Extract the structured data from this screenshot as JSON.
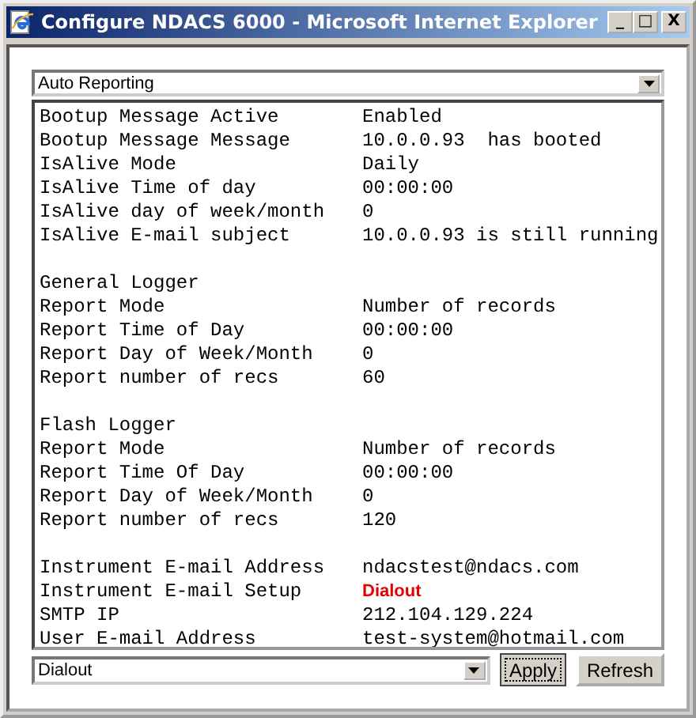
{
  "window": {
    "title": "Configure NDACS 6000 - Microsoft Internet Explorer"
  },
  "title_buttons": [
    "_",
    "□",
    "X"
  ],
  "top_select": {
    "value": "Auto Reporting"
  },
  "sections": [
    {
      "rows": [
        {
          "label": "Bootup Message Active",
          "value": "Enabled",
          "highlighted": false
        },
        {
          "label": "Bootup Message Message",
          "value": "10.0.0.93  has booted",
          "highlighted": false
        },
        {
          "label": "IsAlive Mode",
          "value": "Daily",
          "highlighted": false
        },
        {
          "label": "IsAlive Time of day",
          "value": "00:00:00",
          "highlighted": false
        },
        {
          "label": "IsAlive day of week/month",
          "value": "0",
          "highlighted": false
        },
        {
          "label": "IsAlive E-mail subject",
          "value": "10.0.0.93 is still running",
          "highlighted": false
        }
      ]
    },
    {
      "heading": "General Logger",
      "rows": [
        {
          "label": "Report Mode",
          "value": "Number of records",
          "highlighted": false
        },
        {
          "label": "Report Time of Day",
          "value": "00:00:00",
          "highlighted": false
        },
        {
          "label": "Report Day of Week/Month",
          "value": "0",
          "highlighted": false
        },
        {
          "label": "Report number of recs",
          "value": "60",
          "highlighted": false
        }
      ]
    },
    {
      "heading": "Flash Logger",
      "rows": [
        {
          "label": "Report Mode",
          "value": "Number of records",
          "highlighted": false
        },
        {
          "label": "Report Time Of Day",
          "value": "00:00:00",
          "highlighted": false
        },
        {
          "label": "Report Day of Week/Month",
          "value": "0",
          "highlighted": false
        },
        {
          "label": "Report number of recs",
          "value": "120",
          "highlighted": false
        }
      ]
    },
    {
      "rows": [
        {
          "label": "Instrument E-mail Address",
          "value": "ndacstest@ndacs.com",
          "highlighted": false
        },
        {
          "label": "Instrument E-mail Setup",
          "value": "Dialout",
          "highlighted": true
        },
        {
          "label": "SMTP IP",
          "value": "212.104.129.224",
          "highlighted": false
        },
        {
          "label": "User E-mail Address",
          "value": "test-system@hotmail.com",
          "highlighted": false
        }
      ]
    }
  ],
  "bottom_select": {
    "value": "Dialout"
  },
  "buttons": [
    {
      "label": "Apply",
      "focused": true
    },
    {
      "label": "Refresh",
      "focused": false
    }
  ]
}
